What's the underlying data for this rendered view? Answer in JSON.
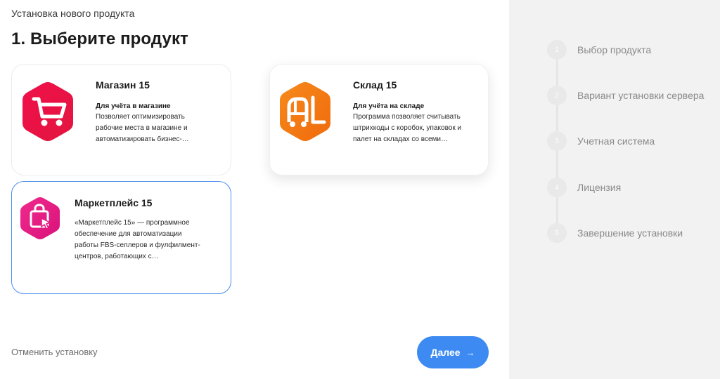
{
  "header": {
    "breadcrumb": "Установка нового продукта",
    "title": "1. Выберите продукт"
  },
  "products": [
    {
      "title": "Магазин 15",
      "subtitle": "Для учёта в магазине",
      "description_lines": [
        "Позволяет оптимизировать",
        "рабочие места в магазине и",
        "автоматизировать бизнес-…"
      ],
      "icon": "shopping-cart-icon",
      "color": "#ee1d4f"
    },
    {
      "title": "Склад 15",
      "subtitle": "Для учёта на складе",
      "description_lines": [
        "Программа позволяет считывать",
        "штрихкоды с коробок, упаковок и",
        "палет на складах со всеми…"
      ],
      "icon": "forklift-icon",
      "color": "#f57c12"
    },
    {
      "title": "Маркетплейс 15",
      "subtitle": "",
      "description_lines": [
        "«Маркетплейс 15» — программное",
        "обеспечение для автоматизации",
        "работы FBS-селлеров и фулфилмент-",
        "центров, работающих с…"
      ],
      "icon": "shopping-bag-cursor-icon",
      "color": "#e8197e"
    }
  ],
  "footer": {
    "cancel_label": "Отменить установку",
    "next_label": "Далее",
    "next_icon": "→"
  },
  "steps": [
    {
      "number": "1",
      "label": "Выбор продукта"
    },
    {
      "number": "2",
      "label": "Вариант установки сервера"
    },
    {
      "number": "3",
      "label": "Учетная система"
    },
    {
      "number": "4",
      "label": "Лицензия"
    },
    {
      "number": "5",
      "label": "Завершение установки"
    }
  ],
  "colors": {
    "accent": "#3d8bf2",
    "sidebar_bg": "#f2f2f2",
    "selected_border": "#4a8ff0"
  }
}
